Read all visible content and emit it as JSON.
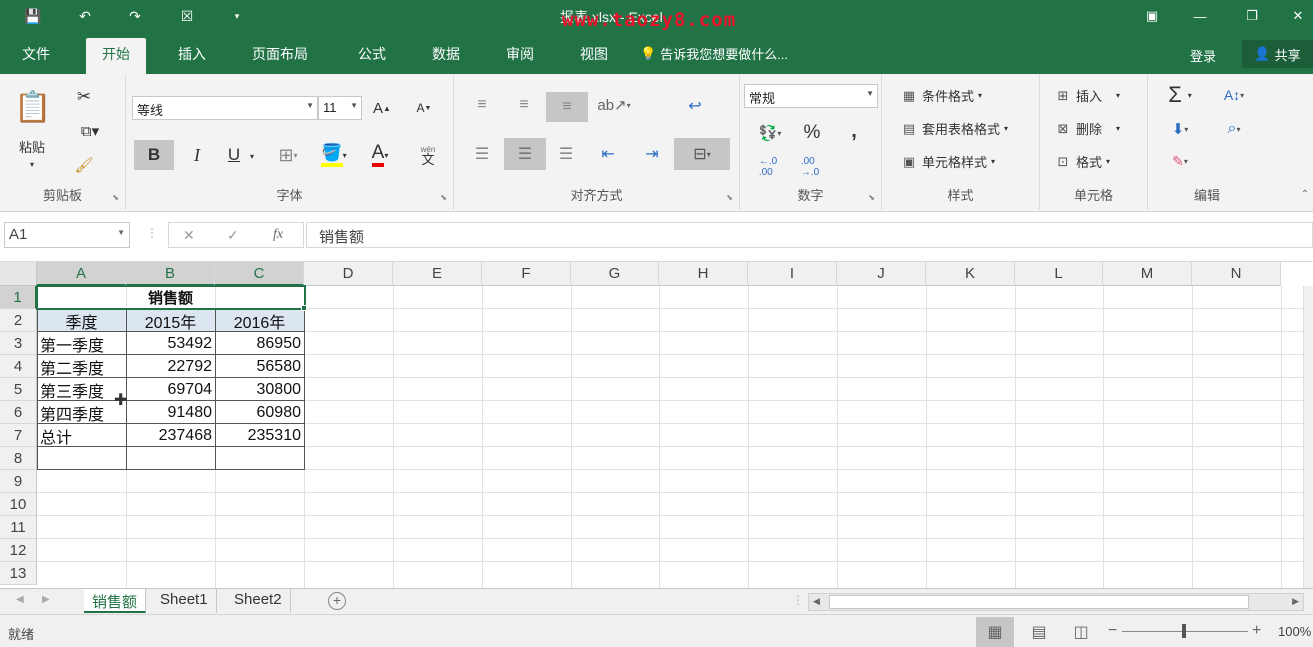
{
  "titlebar": {
    "title": "报表.xlsx - Excel",
    "watermark": "www.taozy8.com",
    "qat": {
      "save_icon": "save-icon",
      "undo_icon": "undo-icon",
      "redo_icon": "redo-icon",
      "touch_icon": "touch-mode-icon"
    }
  },
  "tabs": {
    "file": "文件",
    "home": "开始",
    "insert": "插入",
    "page_layout": "页面布局",
    "formulas": "公式",
    "data": "数据",
    "review": "审阅",
    "view": "视图",
    "tellme": "告诉我您想要做什么...",
    "login": "登录",
    "share": "共享"
  },
  "ribbon": {
    "clipboard": {
      "label": "剪贴板",
      "paste": "粘贴"
    },
    "font": {
      "label": "字体",
      "font_name": "等线",
      "font_size": "11",
      "bold": "B",
      "italic": "I",
      "underline": "U",
      "grow": "A",
      "shrink": "A",
      "font_color": "A",
      "wen": "wén",
      "wen2": "文"
    },
    "alignment": {
      "label": "对齐方式"
    },
    "number": {
      "label": "数字",
      "format": "常规",
      "percent": "%",
      "comma": ","
    },
    "styles": {
      "label": "样式",
      "conditional": "条件格式",
      "as_table": "套用表格格式",
      "cell_styles": "单元格样式"
    },
    "cells": {
      "label": "单元格",
      "insert": "插入",
      "delete": "删除",
      "format": "格式"
    },
    "editing": {
      "label": "编辑"
    }
  },
  "formula_bar": {
    "name_box": "A1",
    "content": "销售额"
  },
  "grid": {
    "columns": [
      "A",
      "B",
      "C",
      "D",
      "E",
      "F",
      "G",
      "H",
      "I",
      "J",
      "K",
      "L",
      "M",
      "N"
    ],
    "rows": [
      "1",
      "2",
      "3",
      "4",
      "5",
      "6",
      "7",
      "8",
      "9",
      "10",
      "11",
      "12",
      "13"
    ],
    "title": "销售额",
    "headers": [
      "季度",
      "2015年",
      "2016年"
    ],
    "data": [
      [
        "第一季度",
        "53492",
        "86950"
      ],
      [
        "第二季度",
        "22792",
        "56580"
      ],
      [
        "第三季度",
        "69704",
        "30800"
      ],
      [
        "第四季度",
        "91480",
        "60980"
      ],
      [
        "总计",
        "237468",
        "235310"
      ]
    ],
    "header_fill": "#dce6f1",
    "accent": "#217346"
  },
  "sheets": [
    "销售额",
    "Sheet1",
    "Sheet2"
  ],
  "status": {
    "ready": "就绪",
    "zoom": "100%"
  }
}
